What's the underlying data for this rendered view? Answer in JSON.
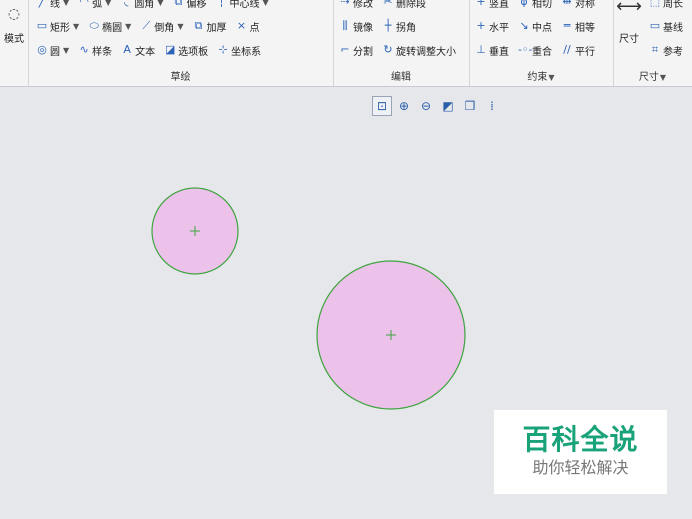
{
  "ribbon": {
    "mode_label": "模式",
    "sketch": {
      "title": "草绘",
      "row1": [
        {
          "icon": "line-icon",
          "glyph": "╱",
          "label": "线",
          "arrow": true
        },
        {
          "icon": "arc-icon",
          "glyph": "◠",
          "label": "弧",
          "arrow": true
        },
        {
          "icon": "fillet-icon",
          "glyph": "◟",
          "label": "圆角",
          "arrow": true
        },
        {
          "icon": "offset-icon",
          "glyph": "⧉",
          "label": "偏移",
          "arrow": false
        },
        {
          "icon": "centerline-icon",
          "glyph": "┆",
          "label": "中心线",
          "arrow": true
        }
      ],
      "row2": [
        {
          "icon": "rectangle-icon",
          "glyph": "▭",
          "label": "矩形",
          "arrow": true
        },
        {
          "icon": "ellipse-icon",
          "glyph": "⬭",
          "label": "椭圆",
          "arrow": true
        },
        {
          "icon": "chamfer-icon",
          "glyph": "⟋",
          "label": "倒角",
          "arrow": true
        },
        {
          "icon": "thicken-icon",
          "glyph": "⧉",
          "label": "加厚",
          "arrow": false
        },
        {
          "icon": "point-icon",
          "glyph": "×",
          "label": "点",
          "arrow": false
        }
      ],
      "row3": [
        {
          "icon": "circle-icon",
          "glyph": "◎",
          "label": "圆",
          "arrow": true
        },
        {
          "icon": "spline-icon",
          "glyph": "∿",
          "label": "样条",
          "arrow": false
        },
        {
          "icon": "text-icon",
          "glyph": "A",
          "label": "文本",
          "arrow": false
        },
        {
          "icon": "palette-icon",
          "glyph": "◪",
          "label": "选项板",
          "arrow": false
        },
        {
          "icon": "coordinate-system-icon",
          "glyph": "⊹",
          "label": "坐标系",
          "arrow": false
        }
      ]
    },
    "edit": {
      "title": "编辑",
      "row1": [
        {
          "icon": "modify-icon",
          "glyph": "⇢",
          "label": "修改"
        },
        {
          "icon": "delete-segment-icon",
          "glyph": "✂",
          "label": "删除段"
        }
      ],
      "row2": [
        {
          "icon": "mirror-icon",
          "glyph": "⫼",
          "label": "镜像"
        },
        {
          "icon": "corner-icon",
          "glyph": "┼",
          "label": "拐角"
        }
      ],
      "row3": [
        {
          "icon": "divide-icon",
          "glyph": "⌐",
          "label": "分割"
        },
        {
          "icon": "rotate-resize-icon",
          "glyph": "↻",
          "label": "旋转调整大小"
        }
      ]
    },
    "constrain": {
      "title": "约束",
      "row1": [
        {
          "icon": "vertical-icon",
          "glyph": "+",
          "label": "竖直"
        },
        {
          "icon": "tangent-icon",
          "glyph": "ϕ",
          "label": "相切"
        },
        {
          "icon": "symmetric-icon",
          "glyph": "⇹",
          "label": "对称"
        }
      ],
      "row2": [
        {
          "icon": "horizontal-icon",
          "glyph": "+",
          "label": "水平"
        },
        {
          "icon": "midpoint-icon",
          "glyph": "↘",
          "label": "中点"
        },
        {
          "icon": "equal-icon",
          "glyph": "═",
          "label": "相等"
        }
      ],
      "row3": [
        {
          "icon": "perpendicular-icon",
          "glyph": "⊥",
          "label": "垂直"
        },
        {
          "icon": "coincident-icon",
          "glyph": "-◦-",
          "label": "重合"
        },
        {
          "icon": "parallel-icon",
          "glyph": "//",
          "label": "平行"
        }
      ]
    },
    "dimension": {
      "title": "尺寸",
      "main_label": "尺寸",
      "row1": [
        {
          "icon": "perimeter-icon",
          "glyph": "⬚",
          "label": "周长"
        }
      ],
      "row2": [
        {
          "icon": "baseline-icon",
          "glyph": "▭",
          "label": "基线"
        }
      ],
      "row3": [
        {
          "icon": "reference-icon",
          "glyph": "⌗",
          "label": "参考"
        }
      ]
    }
  },
  "viewbar": [
    {
      "icon": "refit-icon",
      "glyph": "⊡"
    },
    {
      "icon": "zoom-in-icon",
      "glyph": "⊕"
    },
    {
      "icon": "zoom-out-icon",
      "glyph": "⊖"
    },
    {
      "icon": "repaint-icon",
      "glyph": "◩"
    },
    {
      "icon": "display-style-icon",
      "glyph": "❒"
    },
    {
      "icon": "sketch-display-filter-icon",
      "glyph": "⁞"
    }
  ],
  "watermark": {
    "title": "百科全说",
    "subtitle": "助你轻松解决"
  },
  "colors": {
    "circle_fill": "#ecc2ea",
    "circle_stroke": "#3ea43e",
    "watermark_green": "#1aa37a"
  }
}
